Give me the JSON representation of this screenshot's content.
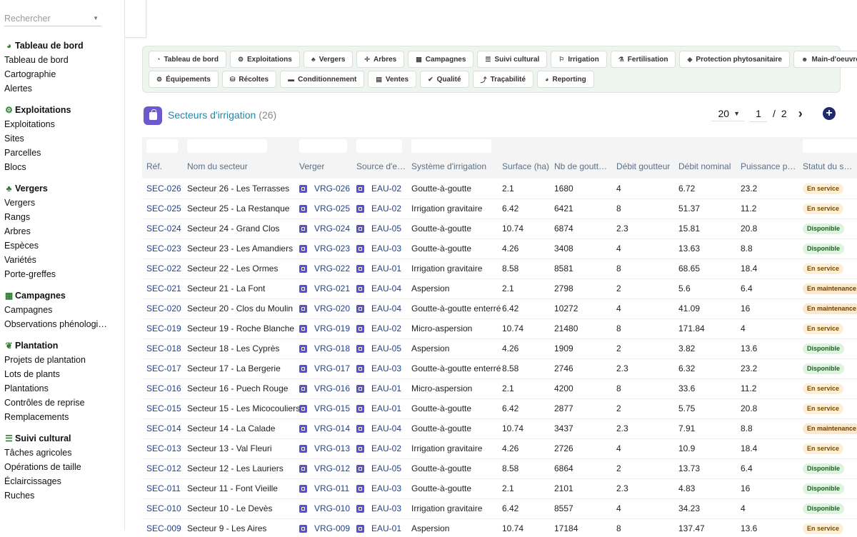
{
  "search": {
    "placeholder": "Rechercher"
  },
  "sidebar": {
    "sections": [
      {
        "title": "Tableau de bord",
        "icon": "dashboard-gauge-icon",
        "items": [
          "Tableau de bord",
          "Cartographie",
          "Alertes"
        ]
      },
      {
        "title": "Exploitations",
        "icon": "tractor-icon",
        "items": [
          "Exploitations",
          "Sites",
          "Parcelles",
          "Blocs"
        ]
      },
      {
        "title": "Vergers",
        "icon": "tree-icon",
        "items": [
          "Vergers",
          "Rangs",
          "Arbres",
          "Espèces",
          "Variétés",
          "Porte-greffes"
        ]
      },
      {
        "title": "Campagnes",
        "icon": "calendar-icon",
        "items": [
          "Campagnes",
          "Observations phénologiq…"
        ]
      },
      {
        "title": "Plantation",
        "icon": "seedling-icon",
        "items": [
          "Projets de plantation",
          "Lots de plants",
          "Plantations",
          "Contrôles de reprise",
          "Remplacements"
        ]
      },
      {
        "title": "Suivi cultural",
        "icon": "list-icon",
        "items": [
          "Tâches agricoles",
          "Opérations de taille",
          "Éclaircissages",
          "Ruches"
        ]
      }
    ]
  },
  "modules": {
    "row1": [
      {
        "label": "Tableau de bord",
        "icon": "dashboard-icon",
        "glyph": "◔"
      },
      {
        "label": "Exploitations",
        "icon": "tractor-icon",
        "glyph": "⚙"
      },
      {
        "label": "Vergers",
        "icon": "tree-icon",
        "glyph": "♣"
      },
      {
        "label": "Arbres",
        "icon": "branch-icon",
        "glyph": "✢"
      },
      {
        "label": "Campagnes",
        "icon": "calendar-icon",
        "glyph": "▦"
      },
      {
        "label": "Suivi cultural",
        "icon": "list-icon",
        "glyph": "☰"
      },
      {
        "label": "Irrigation",
        "icon": "faucet-icon",
        "glyph": "⚐"
      },
      {
        "label": "Fertilisation",
        "icon": "flask-icon",
        "glyph": "⚗"
      },
      {
        "label": "Protection phytosanitaire",
        "icon": "shield-icon",
        "glyph": "◈"
      },
      {
        "label": "Main-d'oeuvre",
        "icon": "people-icon",
        "glyph": "☻"
      }
    ],
    "row2": [
      {
        "label": "Équipements",
        "icon": "tractor-icon",
        "glyph": "⚙"
      },
      {
        "label": "Récoltes",
        "icon": "basket-icon",
        "glyph": "⛁"
      },
      {
        "label": "Conditionnement",
        "icon": "box-icon",
        "glyph": "▬"
      },
      {
        "label": "Ventes",
        "icon": "invoice-icon",
        "glyph": "▤"
      },
      {
        "label": "Qualité",
        "icon": "check-icon",
        "glyph": "✔"
      },
      {
        "label": "Traçabilité",
        "icon": "route-icon",
        "glyph": "⤴"
      },
      {
        "label": "Reporting",
        "icon": "chart-pie-icon",
        "glyph": "◕"
      }
    ]
  },
  "page": {
    "title": "Secteurs d'irrigation",
    "count": "(26)"
  },
  "pagination": {
    "page_size": "20",
    "current_page": "1",
    "separator": "/",
    "total_pages": "2"
  },
  "table": {
    "headers": [
      "Réf.",
      "Nom du secteur",
      "Verger",
      "Source d'eau",
      "Système d'irrigation",
      "Surface (ha)",
      "Nb de goutteurs",
      "Débit goutteur",
      "Débit nominal",
      "Puissance pompe",
      "Statut du secteur"
    ],
    "rows": [
      {
        "ref": "SEC-026",
        "nom": "Secteur 26 - Les Terrasses",
        "verger": "VRG-026",
        "source": "EAU-02",
        "systeme": "Goutte-à-goutte",
        "surface": "2.1",
        "nb": "1680",
        "debit_g": "4",
        "debit_n": "6.72",
        "puissance": "23.2",
        "statut": "En service",
        "kind": "serv"
      },
      {
        "ref": "SEC-025",
        "nom": "Secteur 25 - La Restanque",
        "verger": "VRG-025",
        "source": "EAU-02",
        "systeme": "Irrigation gravitaire",
        "surface": "6.42",
        "nb": "6421",
        "debit_g": "8",
        "debit_n": "51.37",
        "puissance": "11.2",
        "statut": "En service",
        "kind": "serv"
      },
      {
        "ref": "SEC-024",
        "nom": "Secteur 24 - Grand Clos",
        "verger": "VRG-024",
        "source": "EAU-05",
        "systeme": "Goutte-à-goutte",
        "surface": "10.74",
        "nb": "6874",
        "debit_g": "2.3",
        "debit_n": "15.81",
        "puissance": "20.8",
        "statut": "Disponible",
        "kind": "disp"
      },
      {
        "ref": "SEC-023",
        "nom": "Secteur 23 - Les Amandiers",
        "verger": "VRG-023",
        "source": "EAU-03",
        "systeme": "Goutte-à-goutte",
        "surface": "4.26",
        "nb": "3408",
        "debit_g": "4",
        "debit_n": "13.63",
        "puissance": "8.8",
        "statut": "Disponible",
        "kind": "disp"
      },
      {
        "ref": "SEC-022",
        "nom": "Secteur 22 - Les Ormes",
        "verger": "VRG-022",
        "source": "EAU-01",
        "systeme": "Irrigation gravitaire",
        "surface": "8.58",
        "nb": "8581",
        "debit_g": "8",
        "debit_n": "68.65",
        "puissance": "18.4",
        "statut": "En service",
        "kind": "serv"
      },
      {
        "ref": "SEC-021",
        "nom": "Secteur 21 - La Font",
        "verger": "VRG-021",
        "source": "EAU-04",
        "systeme": "Aspersion",
        "surface": "2.1",
        "nb": "2798",
        "debit_g": "2",
        "debit_n": "5.6",
        "puissance": "6.4",
        "statut": "En maintenance",
        "kind": "maint"
      },
      {
        "ref": "SEC-020",
        "nom": "Secteur 20 - Clos du Moulin",
        "verger": "VRG-020",
        "source": "EAU-04",
        "systeme": "Goutte-à-goutte enterré",
        "surface": "6.42",
        "nb": "10272",
        "debit_g": "4",
        "debit_n": "41.09",
        "puissance": "16",
        "statut": "En maintenance",
        "kind": "maint"
      },
      {
        "ref": "SEC-019",
        "nom": "Secteur 19 - Roche Blanche",
        "verger": "VRG-019",
        "source": "EAU-02",
        "systeme": "Micro-aspersion",
        "surface": "10.74",
        "nb": "21480",
        "debit_g": "8",
        "debit_n": "171.84",
        "puissance": "4",
        "statut": "En service",
        "kind": "serv"
      },
      {
        "ref": "SEC-018",
        "nom": "Secteur 18 - Les Cyprès",
        "verger": "VRG-018",
        "source": "EAU-05",
        "systeme": "Aspersion",
        "surface": "4.26",
        "nb": "1909",
        "debit_g": "2",
        "debit_n": "3.82",
        "puissance": "13.6",
        "statut": "Disponible",
        "kind": "disp"
      },
      {
        "ref": "SEC-017",
        "nom": "Secteur 17 - La Bergerie",
        "verger": "VRG-017",
        "source": "EAU-03",
        "systeme": "Goutte-à-goutte enterré",
        "surface": "8.58",
        "nb": "2746",
        "debit_g": "2.3",
        "debit_n": "6.32",
        "puissance": "23.2",
        "statut": "Disponible",
        "kind": "disp"
      },
      {
        "ref": "SEC-016",
        "nom": "Secteur 16 - Puech Rouge",
        "verger": "VRG-016",
        "source": "EAU-01",
        "systeme": "Micro-aspersion",
        "surface": "2.1",
        "nb": "4200",
        "debit_g": "8",
        "debit_n": "33.6",
        "puissance": "11.2",
        "statut": "En service",
        "kind": "serv"
      },
      {
        "ref": "SEC-015",
        "nom": "Secteur 15 - Les Micocouliers",
        "verger": "VRG-015",
        "source": "EAU-01",
        "systeme": "Goutte-à-goutte",
        "surface": "6.42",
        "nb": "2877",
        "debit_g": "2",
        "debit_n": "5.75",
        "puissance": "20.8",
        "statut": "En service",
        "kind": "serv"
      },
      {
        "ref": "SEC-014",
        "nom": "Secteur 14 - La Calade",
        "verger": "VRG-014",
        "source": "EAU-04",
        "systeme": "Goutte-à-goutte",
        "surface": "10.74",
        "nb": "3437",
        "debit_g": "2.3",
        "debit_n": "7.91",
        "puissance": "8.8",
        "statut": "En maintenance",
        "kind": "maint"
      },
      {
        "ref": "SEC-013",
        "nom": "Secteur 13 - Val Fleuri",
        "verger": "VRG-013",
        "source": "EAU-02",
        "systeme": "Irrigation gravitaire",
        "surface": "4.26",
        "nb": "2726",
        "debit_g": "4",
        "debit_n": "10.9",
        "puissance": "18.4",
        "statut": "En service",
        "kind": "serv"
      },
      {
        "ref": "SEC-012",
        "nom": "Secteur 12 - Les Lauriers",
        "verger": "VRG-012",
        "source": "EAU-05",
        "systeme": "Goutte-à-goutte",
        "surface": "8.58",
        "nb": "6864",
        "debit_g": "2",
        "debit_n": "13.73",
        "puissance": "6.4",
        "statut": "Disponible",
        "kind": "disp"
      },
      {
        "ref": "SEC-011",
        "nom": "Secteur 11 - Font Vieille",
        "verger": "VRG-011",
        "source": "EAU-03",
        "systeme": "Goutte-à-goutte",
        "surface": "2.1",
        "nb": "2101",
        "debit_g": "2.3",
        "debit_n": "4.83",
        "puissance": "16",
        "statut": "Disponible",
        "kind": "disp"
      },
      {
        "ref": "SEC-010",
        "nom": "Secteur 10 - Le Devès",
        "verger": "VRG-010",
        "source": "EAU-03",
        "systeme": "Irrigation gravitaire",
        "surface": "6.42",
        "nb": "8557",
        "debit_g": "4",
        "debit_n": "34.23",
        "puissance": "4",
        "statut": "Disponible",
        "kind": "disp"
      },
      {
        "ref": "SEC-009",
        "nom": "Secteur 9 - Les Aires",
        "verger": "VRG-009",
        "source": "EAU-01",
        "systeme": "Aspersion",
        "surface": "10.74",
        "nb": "17184",
        "debit_g": "8",
        "debit_n": "137.47",
        "puissance": "13.6",
        "statut": "En service",
        "kind": "serv"
      }
    ]
  }
}
